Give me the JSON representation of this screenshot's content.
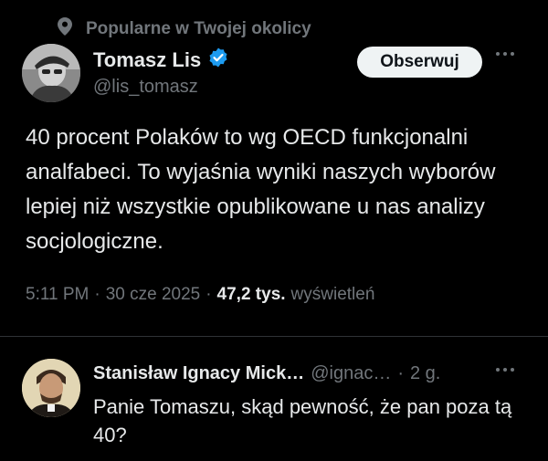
{
  "context": {
    "label": "Popularne w Twojej okolicy",
    "icon": "location-pin-icon"
  },
  "author": {
    "name": "Tomasz Lis",
    "handle": "@lis_tomasz",
    "verified": true,
    "verified_color": "#1d9bf0",
    "follow_label": "Obserwuj"
  },
  "tweet": {
    "text": "40 procent Polaków to wg OECD funkcjonalni analfabeci. To wyjaśnia wyniki naszych wyborów lepiej niż wszystkie opublikowane u nas analizy socjologiczne.",
    "time": "5:11 PM",
    "date": "30 cze 2025",
    "views_count": "47,2 tys.",
    "views_label": "wyświetleń"
  },
  "reply": {
    "name": "Stanisław Ignacy Mick…",
    "handle": "@ignac…",
    "time": "2 g.",
    "text": "Panie Tomaszu, skąd pewność, że pan poza tą 40?"
  },
  "colors": {
    "background": "#000000",
    "text": "#e7e9ea",
    "muted": "#71767b",
    "button_bg": "#eff3f4",
    "divider": "#2f3336"
  }
}
